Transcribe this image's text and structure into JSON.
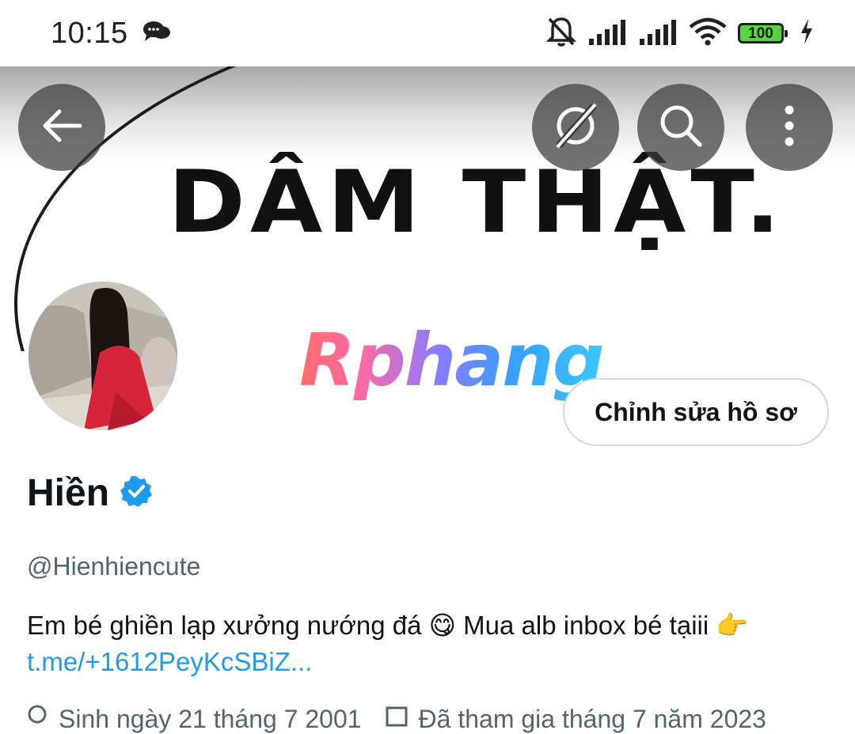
{
  "status_bar": {
    "time": "10:15",
    "battery_level": "100",
    "icons": [
      "chat-bubbles-icon",
      "bell-off-icon",
      "signal-icon",
      "signal-icon",
      "wifi-icon",
      "battery-icon",
      "charging-icon"
    ]
  },
  "banner": {
    "text": "DÂM THẬT."
  },
  "watermark": {
    "text": "Rphang"
  },
  "header_actions": {
    "back_icon": "back-arrow-icon",
    "grok_icon": "grok-icon",
    "search_icon": "search-icon",
    "more_icon": "more-vertical-icon"
  },
  "profile": {
    "edit_button_label": "Chỉnh sửa hồ sơ",
    "name": "Hiền",
    "verified": true,
    "handle": "@Hienhiencute",
    "bio_text": "Em bé ghiền lạp xưởng nướng đá 😋 Mua alb inbox bé tạiii 👉",
    "bio_link": "t.me/+1612PeyKcSBiZ...",
    "birthday": "Sinh ngày 21 tháng 7 2001",
    "joined": "Đã tham gia tháng 7 năm 2023"
  },
  "colors": {
    "link": "#1d9bf0",
    "verified": "#1d9bf0",
    "secondary_text": "#536471",
    "battery_fill": "#5ad33c"
  }
}
